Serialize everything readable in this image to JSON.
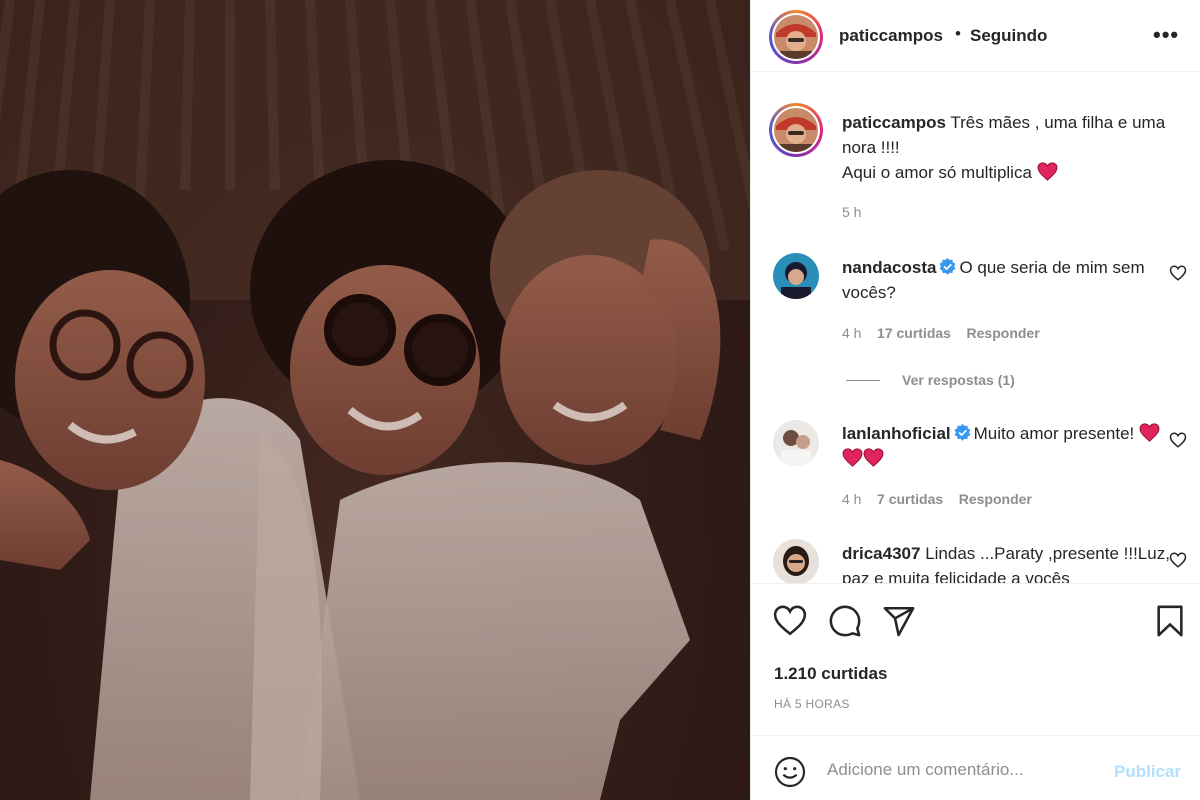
{
  "post": {
    "username": "paticcampos",
    "separator": "•",
    "following_label": "Seguindo",
    "more_label": "•••"
  },
  "caption": {
    "username": "paticcampos",
    "line1": "Três mães , uma filha e uma nora !!!!",
    "line2": "Aqui o amor só multiplica",
    "time": "5 h"
  },
  "comments": [
    {
      "username": "nandacosta",
      "verified": true,
      "text": "O que seria de mim sem vocês?",
      "time": "4 h",
      "likes": "17 curtidas",
      "reply_label": "Responder",
      "view_replies": "Ver respostas (1)"
    },
    {
      "username": "lanlanhoficial",
      "verified": true,
      "text": "Muito amor presente!",
      "time": "4 h",
      "likes": "7 curtidas",
      "reply_label": "Responder"
    },
    {
      "username": "drica4307",
      "verified": false,
      "text": "Lindas ...Paraty ,presente !!!Luz, paz e muita felicidade a vocês"
    }
  ],
  "actions": {
    "like_icon": "heart-outline-icon",
    "comment_icon": "comment-bubble-icon",
    "share_icon": "paper-plane-icon",
    "save_icon": "bookmark-icon"
  },
  "likes_label": "1.210 curtidas",
  "time_ago": "HÁ 5 HORAS",
  "comment_box": {
    "placeholder": "Adicione um comentário...",
    "publish_label": "Publicar"
  },
  "colors": {
    "verified": "#3897f0",
    "publish_disabled": "#b2dffc",
    "meta_text": "#8e8e8e",
    "heart_emoji": "#e0245e"
  }
}
